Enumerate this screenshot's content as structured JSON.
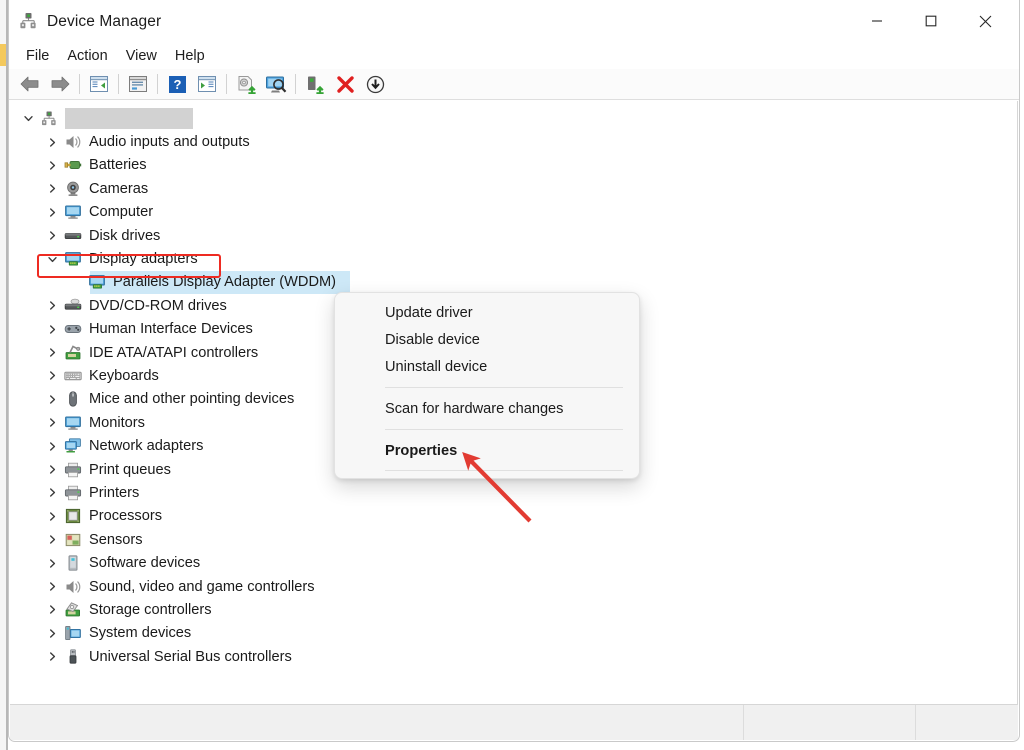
{
  "window": {
    "title": "Device Manager",
    "app_icon": "device-manager-icon",
    "controls": {
      "minimize": "—",
      "maximize": "☐",
      "close": "✕"
    }
  },
  "menubar": {
    "items": [
      {
        "label": "File"
      },
      {
        "label": "Action"
      },
      {
        "label": "View"
      },
      {
        "label": "Help"
      }
    ]
  },
  "toolbar": {
    "buttons": [
      {
        "name": "back-arrow-icon",
        "tooltip": "Back"
      },
      {
        "name": "forward-arrow-icon",
        "tooltip": "Forward"
      },
      {
        "name": "separator-1"
      },
      {
        "name": "show-hide-console-tree-icon",
        "tooltip": "Show/Hide Console Tree"
      },
      {
        "name": "separator-2"
      },
      {
        "name": "properties-window-icon",
        "tooltip": "Properties"
      },
      {
        "name": "separator-3"
      },
      {
        "name": "help-icon",
        "tooltip": "Help"
      },
      {
        "name": "action-pane-icon",
        "tooltip": "Show/Hide Action Pane"
      },
      {
        "name": "separator-4"
      },
      {
        "name": "update-driver-icon",
        "tooltip": "Update driver"
      },
      {
        "name": "scan-for-hardware-changes-icon",
        "tooltip": "Scan for hardware changes"
      },
      {
        "name": "separator-5"
      },
      {
        "name": "disable-device-icon",
        "tooltip": "Disable device"
      },
      {
        "name": "uninstall-device-icon",
        "tooltip": "Uninstall device"
      },
      {
        "name": "enable-device-icon",
        "tooltip": "Enable device"
      }
    ]
  },
  "tree": {
    "root": {
      "label": "",
      "redacted": true,
      "icon": "computer-root-icon",
      "expanded": true
    },
    "items": [
      {
        "label": "Audio inputs and outputs",
        "icon": "speaker-icon",
        "expanded": false,
        "level": 1
      },
      {
        "label": "Batteries",
        "icon": "battery-icon",
        "expanded": false,
        "level": 1
      },
      {
        "label": "Cameras",
        "icon": "camera-icon",
        "expanded": false,
        "level": 1
      },
      {
        "label": "Computer",
        "icon": "monitor-icon",
        "expanded": false,
        "level": 1
      },
      {
        "label": "Disk drives",
        "icon": "disk-drive-icon",
        "expanded": false,
        "level": 1
      },
      {
        "label": "Display adapters",
        "icon": "display-adapter-icon",
        "expanded": true,
        "level": 1,
        "highlighted": true
      },
      {
        "label": "Parallels Display Adapter (WDDM)",
        "icon": "display-adapter-icon",
        "level": 2,
        "selected": true
      },
      {
        "label": "DVD/CD-ROM drives",
        "icon": "dvd-drive-icon",
        "expanded": false,
        "level": 1
      },
      {
        "label": "Human Interface Devices",
        "icon": "gamepad-icon",
        "expanded": false,
        "level": 1
      },
      {
        "label": "IDE ATA/ATAPI controllers",
        "icon": "ide-controller-icon",
        "expanded": false,
        "level": 1
      },
      {
        "label": "Keyboards",
        "icon": "keyboard-icon",
        "expanded": false,
        "level": 1
      },
      {
        "label": "Mice and other pointing devices",
        "icon": "mouse-icon",
        "expanded": false,
        "level": 1
      },
      {
        "label": "Monitors",
        "icon": "monitor-icon",
        "expanded": false,
        "level": 1
      },
      {
        "label": "Network adapters",
        "icon": "network-adapter-icon",
        "expanded": false,
        "level": 1
      },
      {
        "label": "Print queues",
        "icon": "printer-icon",
        "expanded": false,
        "level": 1
      },
      {
        "label": "Printers",
        "icon": "printer-icon",
        "expanded": false,
        "level": 1
      },
      {
        "label": "Processors",
        "icon": "processor-icon",
        "expanded": false,
        "level": 1
      },
      {
        "label": "Sensors",
        "icon": "sensor-icon",
        "expanded": false,
        "level": 1
      },
      {
        "label": "Software devices",
        "icon": "software-device-icon",
        "expanded": false,
        "level": 1
      },
      {
        "label": "Sound, video and game controllers",
        "icon": "speaker-icon",
        "expanded": false,
        "level": 1
      },
      {
        "label": "Storage controllers",
        "icon": "storage-controller-icon",
        "expanded": false,
        "level": 1
      },
      {
        "label": "System devices",
        "icon": "system-device-icon",
        "expanded": false,
        "level": 1
      },
      {
        "label": "Universal Serial Bus controllers",
        "icon": "usb-icon",
        "expanded": false,
        "level": 1
      }
    ]
  },
  "context_menu": {
    "items": [
      {
        "label": "Update driver",
        "bold": false
      },
      {
        "label": "Disable device",
        "bold": false
      },
      {
        "label": "Uninstall device",
        "bold": false
      },
      {
        "separator": true
      },
      {
        "label": "Scan for hardware changes",
        "bold": false
      },
      {
        "separator": true
      },
      {
        "label": "Properties",
        "bold": true
      }
    ]
  },
  "annotations": {
    "highlight_color": "#ee2b22",
    "arrow_color": "#e23b32",
    "box_target": "Display adapters",
    "arrow_target": "Properties"
  },
  "statusbar": {
    "main": "",
    "pane_b": "",
    "pane_c": ""
  },
  "colors": {
    "selection": "#cde8f7",
    "window_bg": "#ffffff",
    "toolbar_bg": "#fbfbfb",
    "statusbar_bg": "#f0f0f0",
    "menu_bg": "#f7f7f7"
  }
}
